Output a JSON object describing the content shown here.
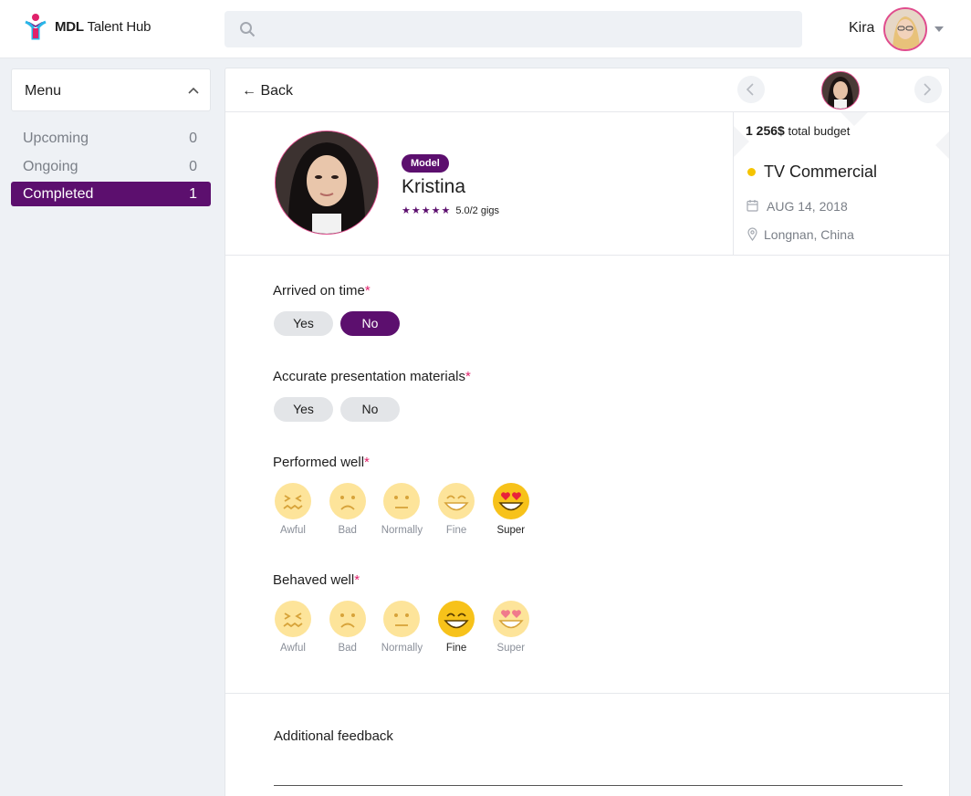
{
  "app": {
    "logo_bold": "MDL",
    "logo_rest": "Talent Hub"
  },
  "user": {
    "name": "Kira"
  },
  "sidebar": {
    "menu_title": "Menu",
    "items": [
      {
        "label": "Upcoming",
        "count": "0"
      },
      {
        "label": "Ongoing",
        "count": "0"
      },
      {
        "label": "Completed",
        "count": "1"
      }
    ]
  },
  "main": {
    "back_label": "← Back"
  },
  "talent": {
    "role": "Model",
    "name": "Kristina",
    "stars": "★★★★★",
    "rating_text": "5.0/2 gigs"
  },
  "gig": {
    "budget_value": "1 256$",
    "budget_label": "total budget",
    "title": "TV Commercial",
    "date": "AUG 14, 2018",
    "location": "Longnan, China"
  },
  "questions": {
    "arrived": {
      "label": "Arrived on time",
      "req": "*",
      "yes": "Yes",
      "no": "No",
      "selected": "no"
    },
    "materials": {
      "label": "Accurate presentation materials",
      "req": "*",
      "yes": "Yes",
      "no": "No",
      "selected": "none"
    },
    "performed": {
      "label": "Performed well",
      "req": "*",
      "selected": "Super"
    },
    "behaved": {
      "label": "Behaved well",
      "req": "*",
      "selected": "Fine"
    },
    "scale": [
      "Awful",
      "Bad",
      "Normally",
      "Fine",
      "Super"
    ]
  },
  "feedback": {
    "label": "Additional feedback"
  },
  "colors": {
    "brand": "#5c0f6e",
    "accent_pink": "#e04d8e",
    "status_dot": "#f5c400",
    "emoji_faded": "#fde49a",
    "emoji_active": "#f7c21a"
  }
}
